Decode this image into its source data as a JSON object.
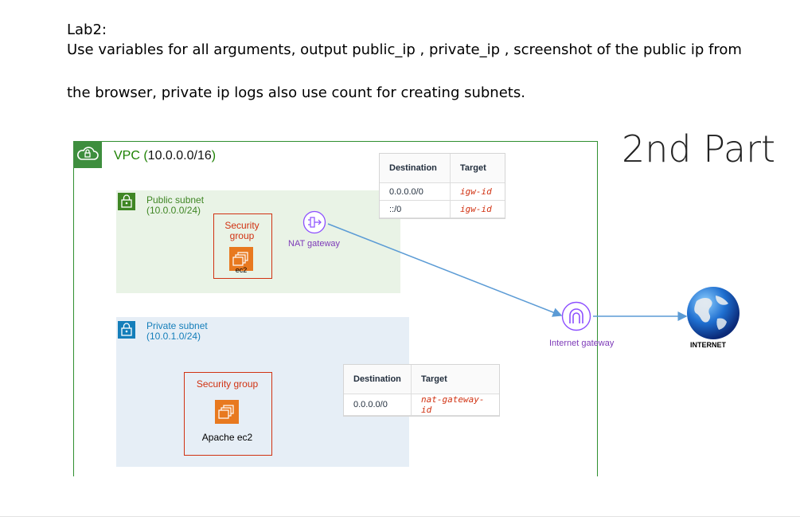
{
  "lab": {
    "title": "Lab2:",
    "line1": "Use variables for all arguments, output public_ip , private_ip , screenshot of the public ip from",
    "line2": "the browser, private ip logs also use count for creating subnets."
  },
  "part_label": "2nd Part",
  "vpc": {
    "prefix": "VPC (",
    "cidr": "10.0.0.0/16",
    "suffix": ")"
  },
  "public_subnet": {
    "name": "Public subnet",
    "cidr": "(10.0.0.0/24)"
  },
  "private_subnet": {
    "name": "Private subnet",
    "cidr": "(10.0.1.0/24)"
  },
  "sg_public": {
    "label_line1": "Security",
    "label_line2": "group",
    "instance": "ec2"
  },
  "sg_private": {
    "label": "Security group",
    "instance": "Apache ec2"
  },
  "nat_gateway": {
    "label": "NAT gateway"
  },
  "internet_gateway": {
    "label": "Internet gateway"
  },
  "internet": {
    "label": "INTERNET"
  },
  "route_table_public": {
    "headers": [
      "Destination",
      "Target"
    ],
    "rows": [
      [
        "0.0.0.0/0",
        "igw-id"
      ],
      [
        "::/0",
        "igw-id"
      ]
    ]
  },
  "route_table_private": {
    "headers": [
      "Destination",
      "Target"
    ],
    "rows": [
      [
        "0.0.0.0/0",
        "nat-gateway-id"
      ]
    ]
  },
  "colors": {
    "vpc_green": "#1d8102",
    "public_fill": "#e9f3e6",
    "private_fill": "#e6eef6",
    "security_group_red": "#d13212",
    "gateway_purple": "#7d3ab8",
    "connector_blue": "#5b9bd5",
    "ec2_orange": "#e8791f"
  }
}
